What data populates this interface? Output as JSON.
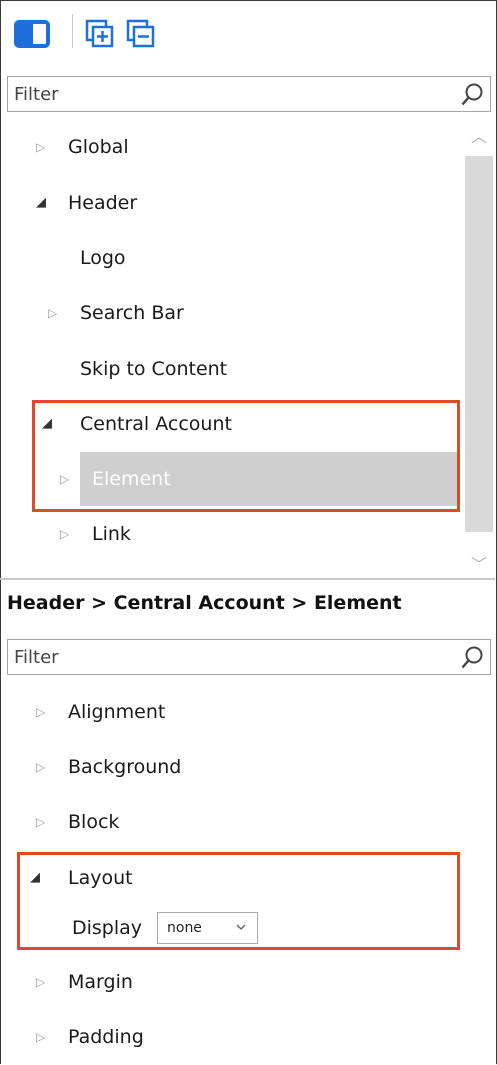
{
  "top_filter": {
    "placeholder": "Filter"
  },
  "tree": {
    "items": [
      {
        "label": "Global",
        "expanded": false
      },
      {
        "label": "Header",
        "expanded": true
      },
      {
        "label": "Logo"
      },
      {
        "label": "Search Bar",
        "expanded": false
      },
      {
        "label": "Skip to Content"
      },
      {
        "label": "Central Account",
        "expanded": true
      },
      {
        "label": "Element",
        "expanded": false,
        "selected": true
      },
      {
        "label": "Link",
        "expanded": false
      }
    ]
  },
  "breadcrumb": "Header > Central Account > Element",
  "props_filter": {
    "placeholder": "Filter"
  },
  "properties": {
    "groups": [
      {
        "label": "Alignment",
        "expanded": false
      },
      {
        "label": "Background",
        "expanded": false
      },
      {
        "label": "Block",
        "expanded": false
      },
      {
        "label": "Layout",
        "expanded": true
      },
      {
        "label": "Margin",
        "expanded": false
      },
      {
        "label": "Padding",
        "expanded": false
      }
    ],
    "display_label": "Display",
    "display_value": "none"
  },
  "colors": {
    "accent_blue": "#1e6fd9",
    "highlight_red": "#dc4a2a",
    "selection_gray": "#cfcfcf"
  }
}
